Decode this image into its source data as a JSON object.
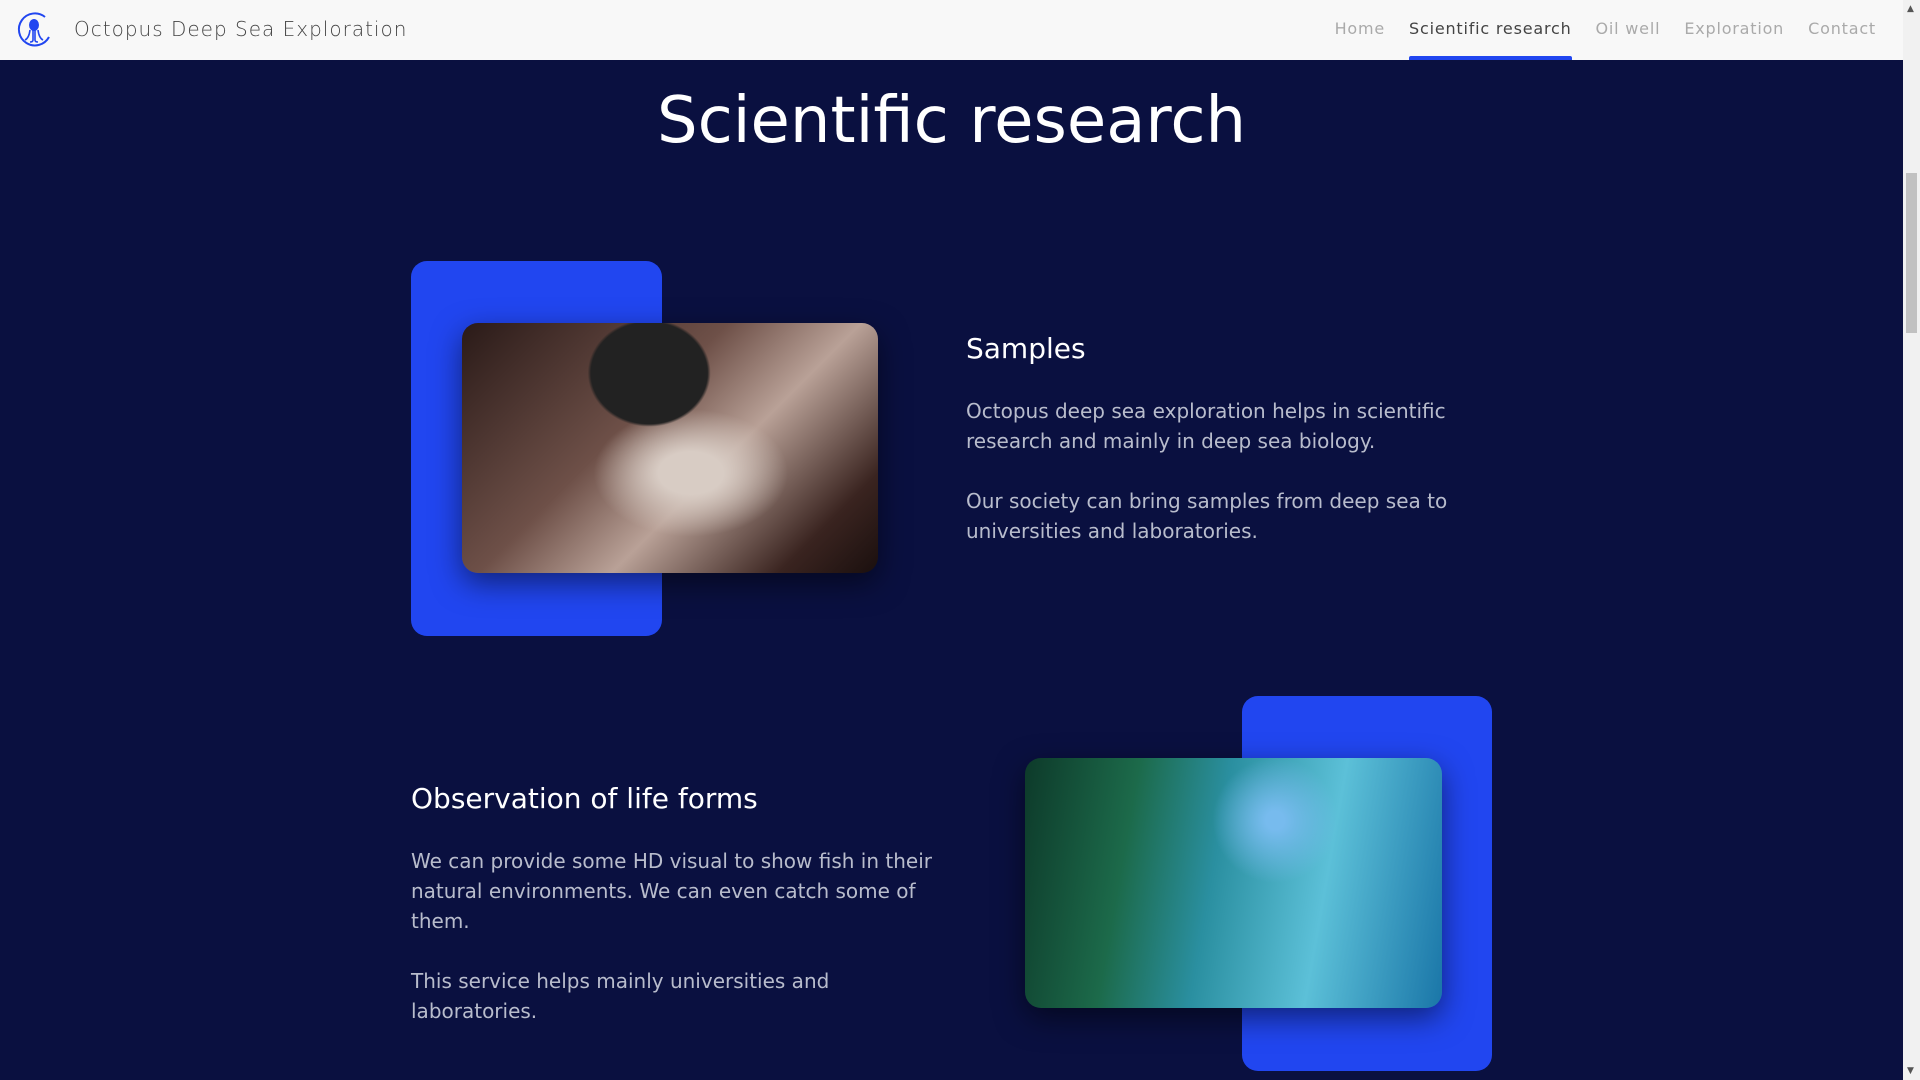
{
  "header": {
    "brand": "Octopus Deep Sea Exploration",
    "nav": [
      {
        "label": "Home"
      },
      {
        "label": "Scientific research",
        "active": true
      },
      {
        "label": "Oil well"
      },
      {
        "label": "Exploration"
      },
      {
        "label": "Contact"
      }
    ]
  },
  "page": {
    "title": "Scientific research"
  },
  "sections": [
    {
      "title": "Samples",
      "paragraphs": [
        "Octopus deep sea exploration helps in scientific research and mainly in deep sea biology.",
        "Our society can bring samples from deep sea to universities and laboratories."
      ],
      "image": "microscope-photo"
    },
    {
      "title": "Observation of life forms",
      "paragraphs": [
        "We can provide some HD visual to show fish in their natural environments. We can even catch some of them.",
        "This service helps mainly universities and laboratories."
      ],
      "image": "divers-reef-photo"
    }
  ],
  "colors": {
    "accent": "#2146f0",
    "background": "#0a1040"
  }
}
